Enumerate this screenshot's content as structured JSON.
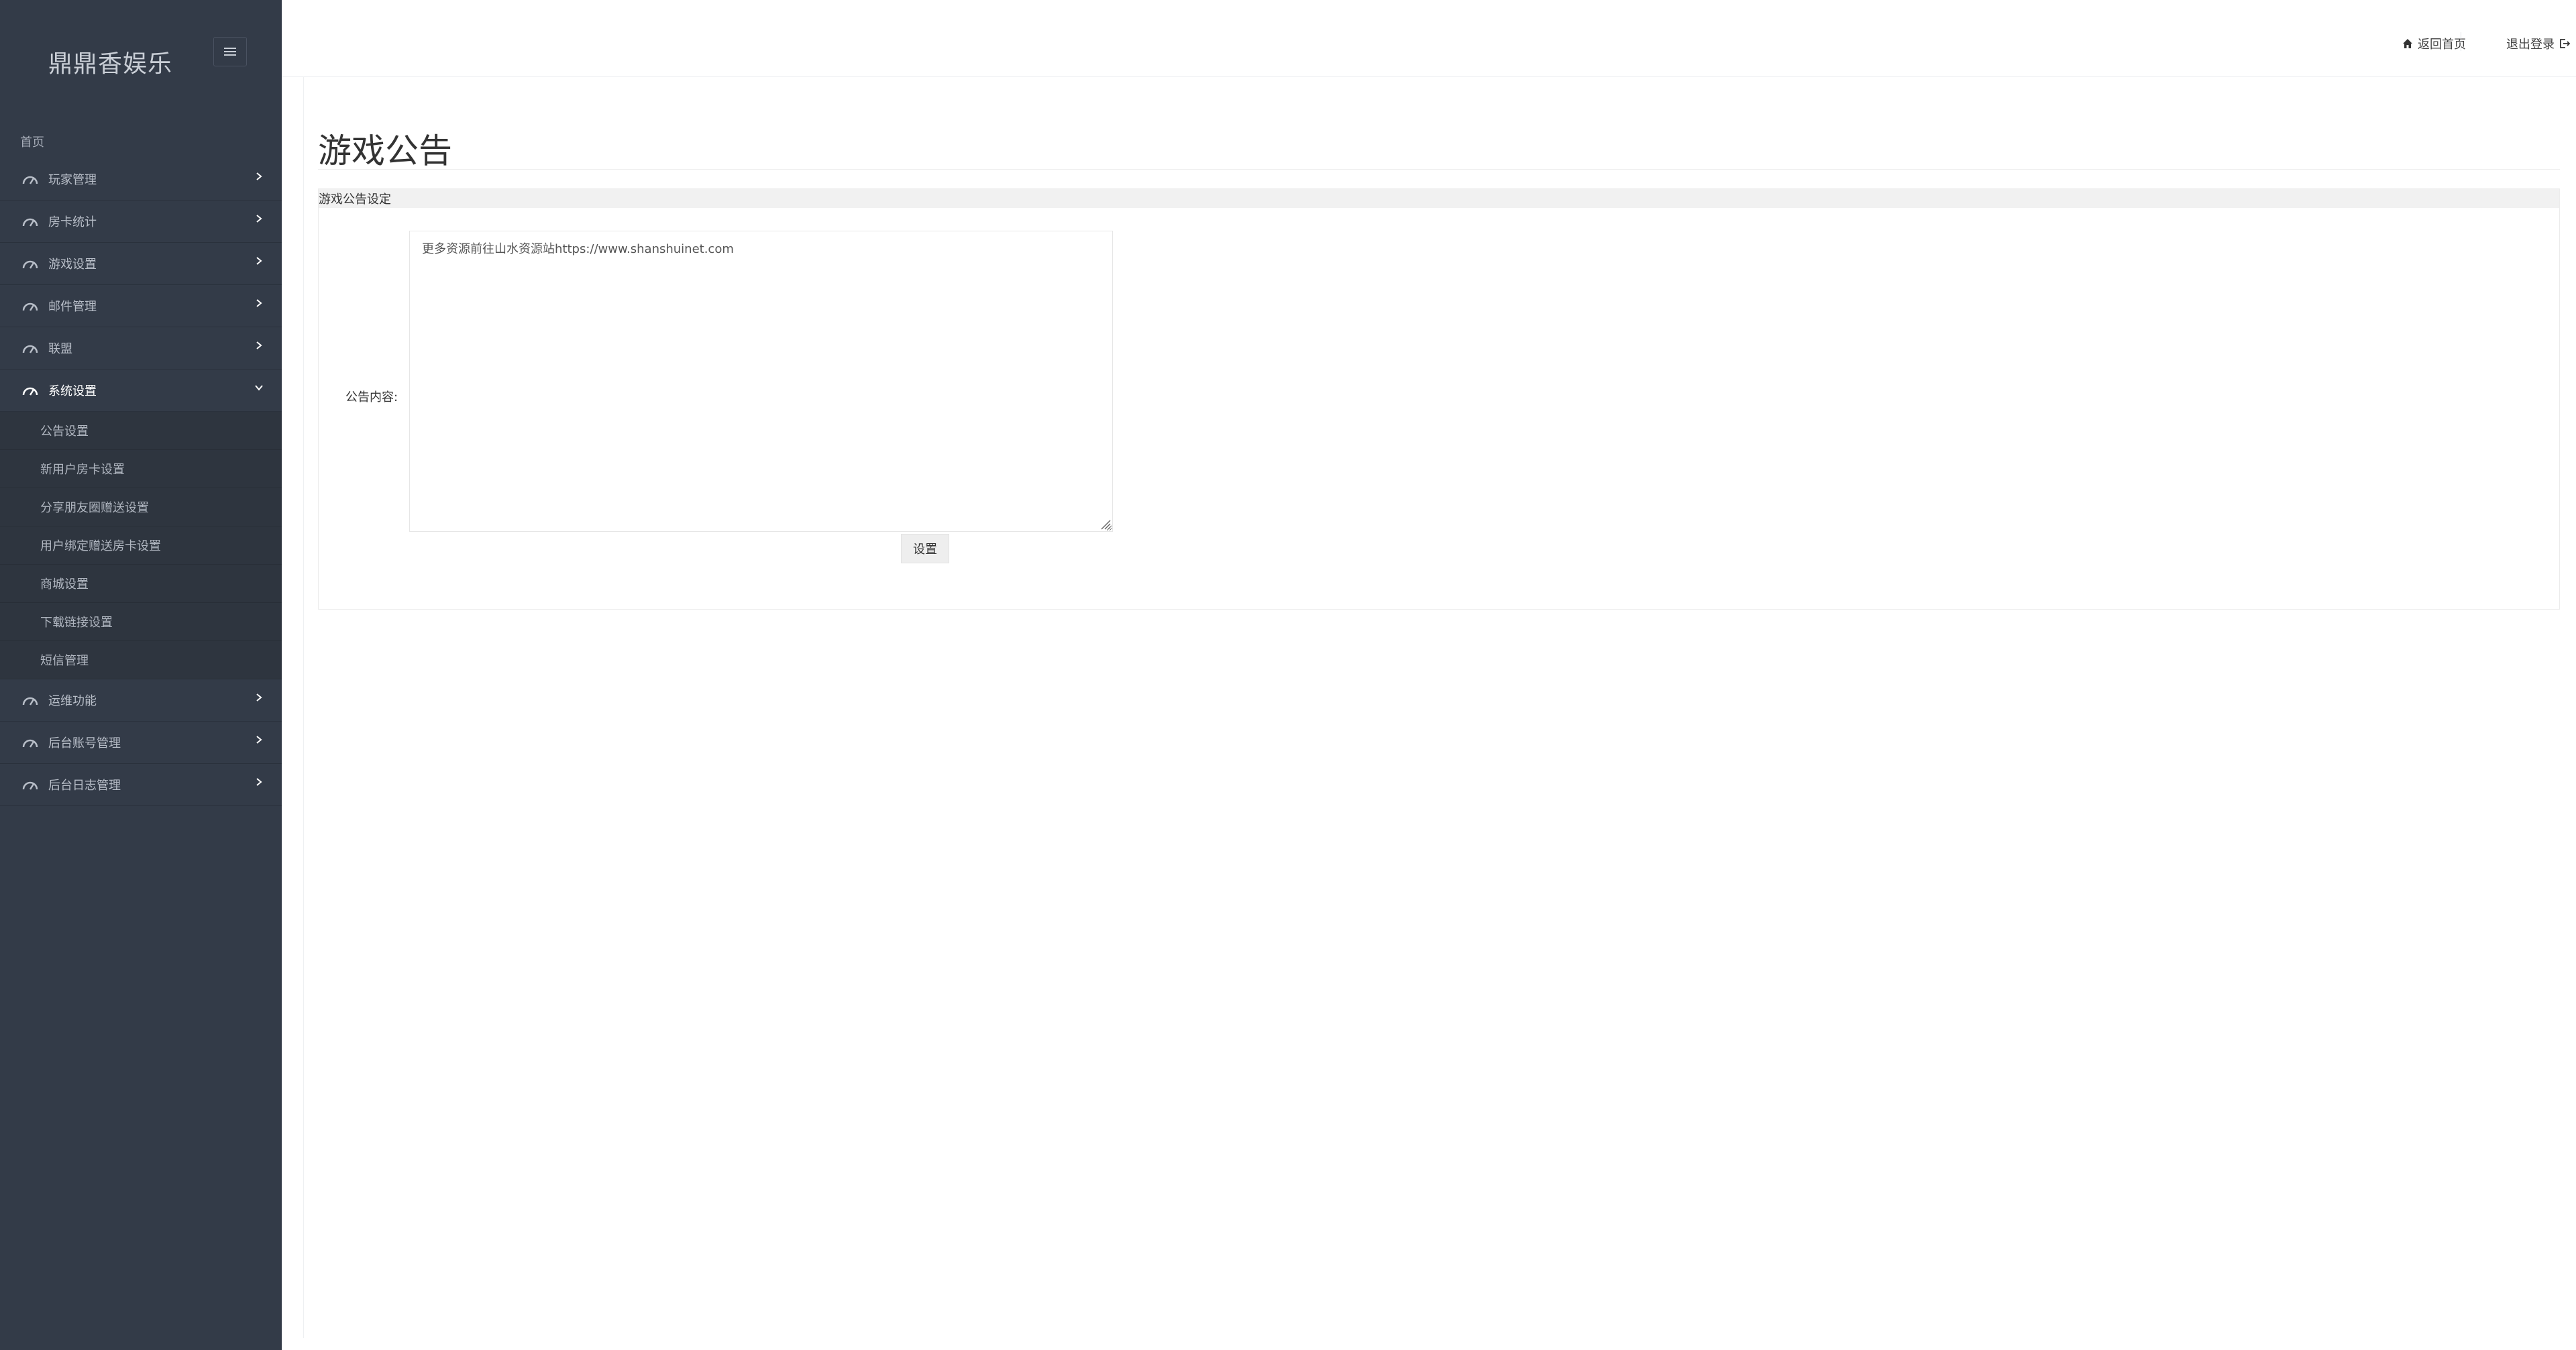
{
  "sidebar": {
    "brand": "鼎鼎香娱乐",
    "home": "首页",
    "items": [
      {
        "label": "玩家管理"
      },
      {
        "label": "房卡统计"
      },
      {
        "label": "游戏设置"
      },
      {
        "label": "邮件管理"
      },
      {
        "label": "联盟"
      },
      {
        "label": "系统设置"
      },
      {
        "label": "运维功能"
      },
      {
        "label": "后台账号管理"
      },
      {
        "label": "后台日志管理"
      }
    ],
    "sub_items": [
      {
        "label": "公告设置"
      },
      {
        "label": "新用户房卡设置"
      },
      {
        "label": "分享朋友圈赠送设置"
      },
      {
        "label": "用户绑定赠送房卡设置"
      },
      {
        "label": "商城设置"
      },
      {
        "label": "下载链接设置"
      },
      {
        "label": "短信管理"
      }
    ]
  },
  "topbar": {
    "home_link": "返回首页",
    "logout_link": "退出登录"
  },
  "main": {
    "title": "游戏公告",
    "panel_title": "游戏公告设定",
    "field_label": "公告内容:",
    "notice_value": "更多资源前往山水资源站https://www.shanshuinet.com",
    "submit_label": "设置"
  },
  "icons": {
    "menu": "gauge-icon",
    "toggle": "hamburger-icon",
    "home": "home-icon",
    "logout": "logout-icon"
  },
  "colors": {
    "sidebar_bg": "#333b48",
    "sidebar_text": "#b8bec8",
    "active_text": "#ffffff"
  }
}
